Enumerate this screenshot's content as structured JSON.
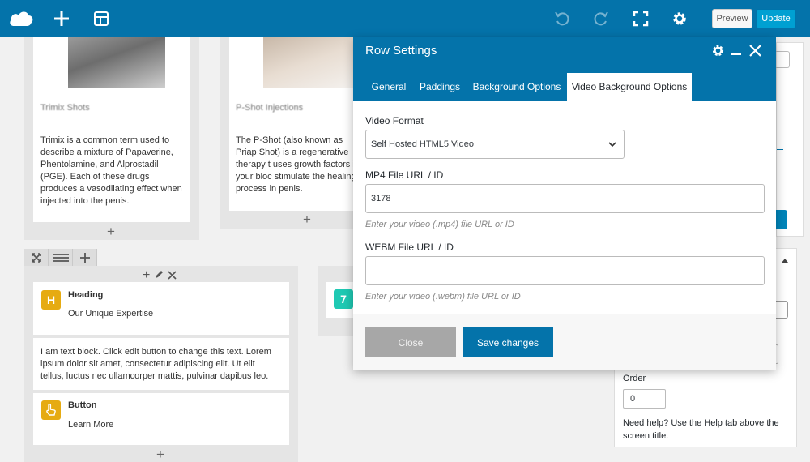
{
  "topbar": {
    "logo_icon": "cloud-logo-icon",
    "add_icon": "plus-icon",
    "layout_icon": "layout-template-icon",
    "undo_icon": "undo-icon",
    "redo_icon": "redo-icon",
    "fullscreen_icon": "fullscreen-icon",
    "settings_icon": "gear-icon",
    "preview_label": "Preview",
    "update_label": "Update",
    "bar_color": "#0473aa",
    "update_color": "#00a0d2"
  },
  "canvas": {
    "cards": [
      {
        "title": "Trimix Shots",
        "text": "Trimix is a common term used to describe a mixture of Papaverine, Phentolamine, and Alprostadil (PGE). Each of these drugs produces a vasodilating effect when injected into the penis."
      },
      {
        "title": "P-Shot Injections",
        "text": "The P-Shot (also known as Priap Shot) is a regenerative therapy t uses growth factors in your bloc stimulate the healing process in penis."
      }
    ],
    "row_controls": {
      "expand_icon": "expand-arrows-icon",
      "columns_icon": "columns-icon",
      "add_icon": "plus-icon"
    },
    "elements": {
      "heading": {
        "icon_letter": "H",
        "name": "Heading",
        "value": "Our Unique Expertise"
      },
      "text_block": "I am text block. Click edit button to change this text. Lorem ipsum dolor sit amet, consectetur adipiscing elit. Ut elit tellus, luctus nec ullamcorper mattis, pulvinar dapibus leo.",
      "button": {
        "icon": "hand-pointer-icon",
        "name": "Button",
        "value": "Learn More"
      },
      "partial_badge": "7"
    }
  },
  "sidebar": {
    "order_label": "Order",
    "order_value": "0",
    "help_text": "Need help? Use the Help tab above the screen title."
  },
  "modal": {
    "title": "Row Settings",
    "gear_icon": "gear-icon",
    "minimize_icon": "minimize-icon",
    "close_icon": "close-icon",
    "tabs": [
      {
        "label": "General"
      },
      {
        "label": "Paddings"
      },
      {
        "label": "Background Options"
      },
      {
        "label": "Video Background Options"
      }
    ],
    "active_tab": "Video Background Options",
    "video_format_label": "Video Format",
    "video_format_value": "Self Hosted HTML5 Video",
    "mp4_label": "MP4 File URL / ID",
    "mp4_value": "3178",
    "mp4_help": "Enter your video (.mp4) file URL or ID",
    "webm_label": "WEBM File URL / ID",
    "webm_value": "",
    "webm_help": "Enter your video (.webm) file URL or ID",
    "close_label": "Close",
    "save_label": "Save changes"
  }
}
